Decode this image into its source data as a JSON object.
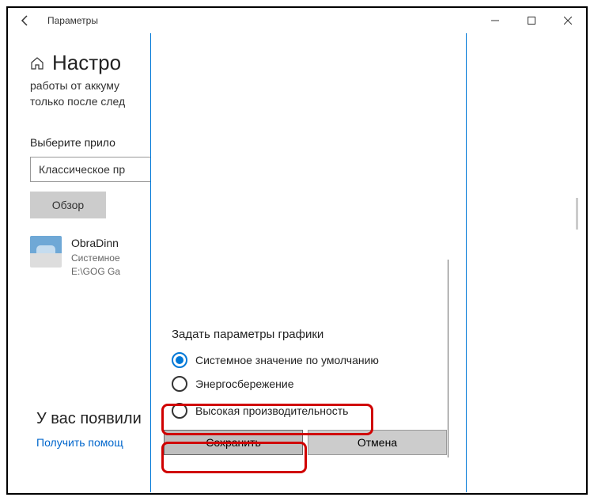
{
  "window": {
    "title": "Параметры"
  },
  "page": {
    "heading": "Настро",
    "desc_line1": "работы от аккуму",
    "desc_line2": "только после след",
    "select_label": "Выберите прило",
    "select_value": "Классическое пр",
    "browse_button": "Обзор"
  },
  "app": {
    "name": "ObraDinn",
    "line1": "Системное",
    "line2": "E:\\GOG Ga"
  },
  "footer": {
    "question": "У вас появили",
    "link": "Получить помощ"
  },
  "dialog": {
    "title": "Задать параметры графики",
    "options": [
      "Системное значение по умолчанию",
      "Энергосбережение",
      "Высокая производительность"
    ],
    "save": "Сохранить",
    "cancel": "Отмена"
  }
}
